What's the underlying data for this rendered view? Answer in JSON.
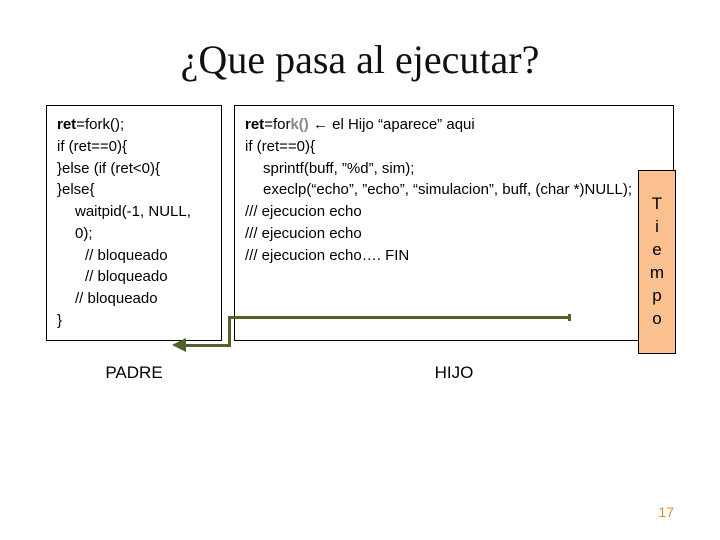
{
  "title": "¿Que pasa al ejecutar?",
  "left": {
    "l1a": "ret",
    "l1b": "=fork();",
    "l2": "if (ret==0){",
    "l3": "}else (if (ret<0){",
    "l4": "}else{",
    "l5": "waitpid(-1, NULL, 0);",
    "l6": "// bloqueado",
    "l7": "// bloqueado",
    "l8": "// bloqueado",
    "l9": "}"
  },
  "right": {
    "l1a": "ret",
    "l1b": "=for",
    "l1c": "k()",
    "l1d": " ← el Hijo “aparece” aqui",
    "l2": "if (ret==0){",
    "l3": "sprintf(buff, ”%d”, sim);",
    "l4": "execlp(“echo”, ”echo”, “simulacion”, buff, (char *)NULL);",
    "l5": "/// ejecucion echo",
    "l6": "/// ejecucion echo",
    "l7": "/// ejecucion echo…. FIN"
  },
  "tiempo": {
    "t0": "T",
    "t1": "i",
    "t2": "e",
    "t3": "m",
    "t4": "p",
    "t5": "o"
  },
  "labels": {
    "padre": "PADRE",
    "hijo": "HIJO"
  },
  "pagenum": "17"
}
